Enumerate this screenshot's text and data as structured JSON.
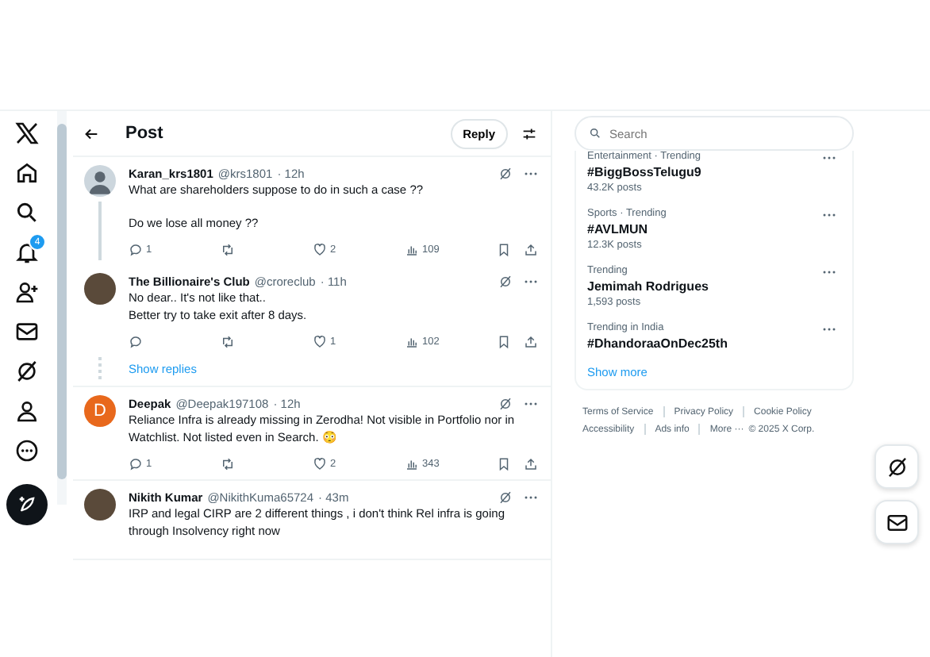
{
  "nav": {
    "notifications_badge": "4"
  },
  "header": {
    "title": "Post",
    "reply_button": "Reply"
  },
  "posts": [
    {
      "author": "Karan_krs1801",
      "handle": "@krs1801",
      "time": "· 12h",
      "kind": "silhouette",
      "paragraphs": [
        "What are shareholders suppose to do in such a case ??",
        "Do we lose all money ??"
      ],
      "replies": "1",
      "likes": "2",
      "views": "109",
      "connected": true
    },
    {
      "author": "The Billionaire's Club",
      "handle": "@croreclub",
      "time": "· 11h",
      "kind": "photo",
      "paragraphs": [
        "No dear.. It's not like that..\nBetter try to take exit after 8 days."
      ],
      "likes": "1",
      "views": "102",
      "connected": false,
      "show_replies": "Show replies"
    },
    {
      "author": "Deepak",
      "handle": "@Deepak197108",
      "time": "· 12h",
      "kind": "initial",
      "initial": "D",
      "color": "#e8681c",
      "paragraphs": [
        "Reliance Infra is already missing in Zerodha! Not visible in Portfolio nor in Watchlist. Not listed even in Search. 😳"
      ],
      "replies": "1",
      "likes": "2",
      "views": "343",
      "connected": false
    },
    {
      "author": "Nikith Kumar",
      "handle": "@NikithKuma65724",
      "time": "· 43m",
      "kind": "photo",
      "paragraphs": [
        "IRP and legal CIRP are 2 different things , i don't think Rel infra is going through Insolvency right now"
      ],
      "connected": false
    }
  ],
  "search": {
    "placeholder": "Search"
  },
  "trends": [
    {
      "context": "Entertainment · Trending",
      "name": "#BiggBossTelugu9",
      "posts": "43.2K posts"
    },
    {
      "context": "Sports · Trending",
      "name": "#AVLMUN",
      "posts": "12.3K posts"
    },
    {
      "context": "Trending",
      "name": "Jemimah Rodrigues",
      "posts": "1,593 posts"
    },
    {
      "context": "Trending in India",
      "name": "#DhandoraaOnDec25th"
    }
  ],
  "show_more": "Show more",
  "footer": {
    "links": [
      "Terms of Service",
      "Privacy Policy",
      "Cookie Policy",
      "Accessibility",
      "Ads info",
      "More ···"
    ],
    "copyright": "© 2025 X Corp."
  }
}
